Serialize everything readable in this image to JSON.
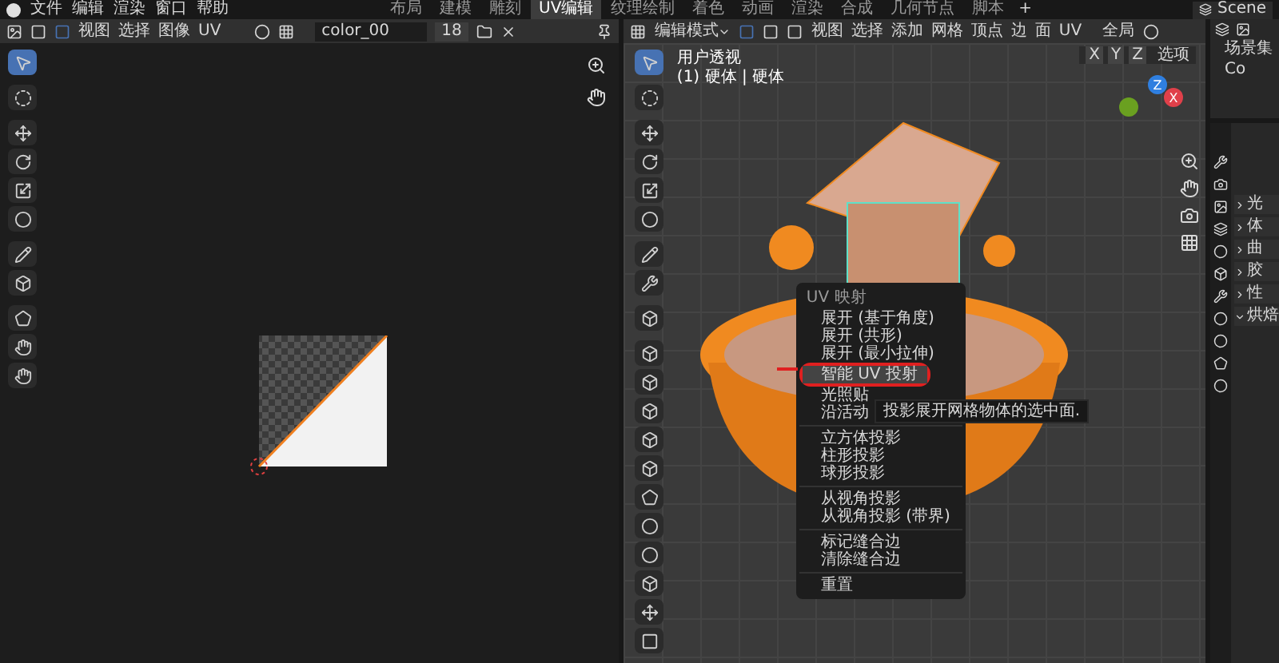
{
  "menubar": {
    "menus": [
      "文件",
      "编辑",
      "渲染",
      "窗口",
      "帮助"
    ],
    "workspaces": [
      {
        "label": "布局",
        "selected": false
      },
      {
        "label": "建模",
        "selected": false
      },
      {
        "label": "雕刻",
        "selected": false
      },
      {
        "label": "UV编辑",
        "selected": true
      },
      {
        "label": "纹理绘制",
        "selected": false
      },
      {
        "label": "着色",
        "selected": false
      },
      {
        "label": "动画",
        "selected": false
      },
      {
        "label": "渲染",
        "selected": false
      },
      {
        "label": "合成",
        "selected": false
      },
      {
        "label": "几何节点",
        "selected": false
      },
      {
        "label": "脚本",
        "selected": false
      }
    ],
    "add": "+",
    "scene": "Scene"
  },
  "uv_editor": {
    "header": {
      "menus": [
        "视图",
        "选择",
        "图像",
        "UV"
      ],
      "image_name": "color_00",
      "users": "18"
    },
    "tools": [
      {
        "selected": true
      },
      {
        "selected": false
      },
      {
        "selected": false
      },
      {
        "selected": false
      },
      {
        "selected": false
      },
      {
        "selected": false
      },
      {
        "selected": false
      },
      {
        "selected": false
      },
      {
        "selected": false
      },
      {
        "selected": false
      },
      {
        "selected": false
      }
    ]
  },
  "viewport": {
    "header": {
      "mode": "编辑模式",
      "menus": [
        "视图",
        "选择",
        "添加",
        "网格",
        "顶点",
        "边",
        "面",
        "UV"
      ],
      "orientation": "全局",
      "axes": [
        "X",
        "Y",
        "Z"
      ],
      "options": "选项"
    },
    "overlay_text": [
      "用户透视",
      "(1) 硬体 | 硬体"
    ],
    "gizmo": [
      {
        "label": "Z"
      },
      {
        "label": "X"
      }
    ],
    "tools": [
      {
        "selected": true
      },
      {
        "selected": false
      },
      {
        "selected": false
      },
      {
        "selected": false
      },
      {
        "selected": false
      },
      {
        "selected": false
      },
      {
        "selected": false
      },
      {
        "selected": false
      },
      {
        "selected": false
      },
      {
        "selected": false
      },
      {
        "selected": false
      },
      {
        "selected": false
      },
      {
        "selected": false
      },
      {
        "selected": false
      },
      {
        "selected": false
      },
      {
        "selected": false
      },
      {
        "selected": false
      },
      {
        "selected": false
      },
      {
        "selected": false
      },
      {
        "selected": false
      }
    ],
    "context_menu": {
      "title": "UV 映射",
      "groups": [
        [
          {
            "label": "展开 (基于角度)",
            "highlighted": false
          },
          {
            "label": "展开 (共形)",
            "highlighted": false
          },
          {
            "label": "展开 (最小拉伸)",
            "highlighted": false
          },
          {
            "label": "智能 UV 投射",
            "highlighted": true
          },
          {
            "label": "光照贴",
            "highlighted": false
          },
          {
            "label": "沿活动",
            "highlighted": false
          }
        ],
        [
          {
            "label": "立方体投影",
            "highlighted": false
          },
          {
            "label": "柱形投影",
            "highlighted": false
          },
          {
            "label": "球形投影",
            "highlighted": false
          }
        ],
        [
          {
            "label": "从视角投影",
            "highlighted": false
          },
          {
            "label": "从视角投影 (带界)",
            "highlighted": false
          }
        ],
        [
          {
            "label": "标记缝合边",
            "highlighted": false
          },
          {
            "label": "清除缝合边",
            "highlighted": false
          }
        ],
        [
          {
            "label": "重置",
            "highlighted": false
          }
        ]
      ]
    },
    "tooltip": "投影展开网格物体的选中面."
  },
  "outliner": {
    "items": [
      "场景集",
      "Co"
    ]
  },
  "properties": {
    "rows": [
      {
        "label": "光",
        "expanded": false
      },
      {
        "label": "体",
        "expanded": false
      },
      {
        "label": "曲",
        "expanded": false
      },
      {
        "label": "胶",
        "expanded": false
      },
      {
        "label": "性",
        "expanded": false
      },
      {
        "label": "烘焙",
        "expanded": true
      }
    ]
  }
}
